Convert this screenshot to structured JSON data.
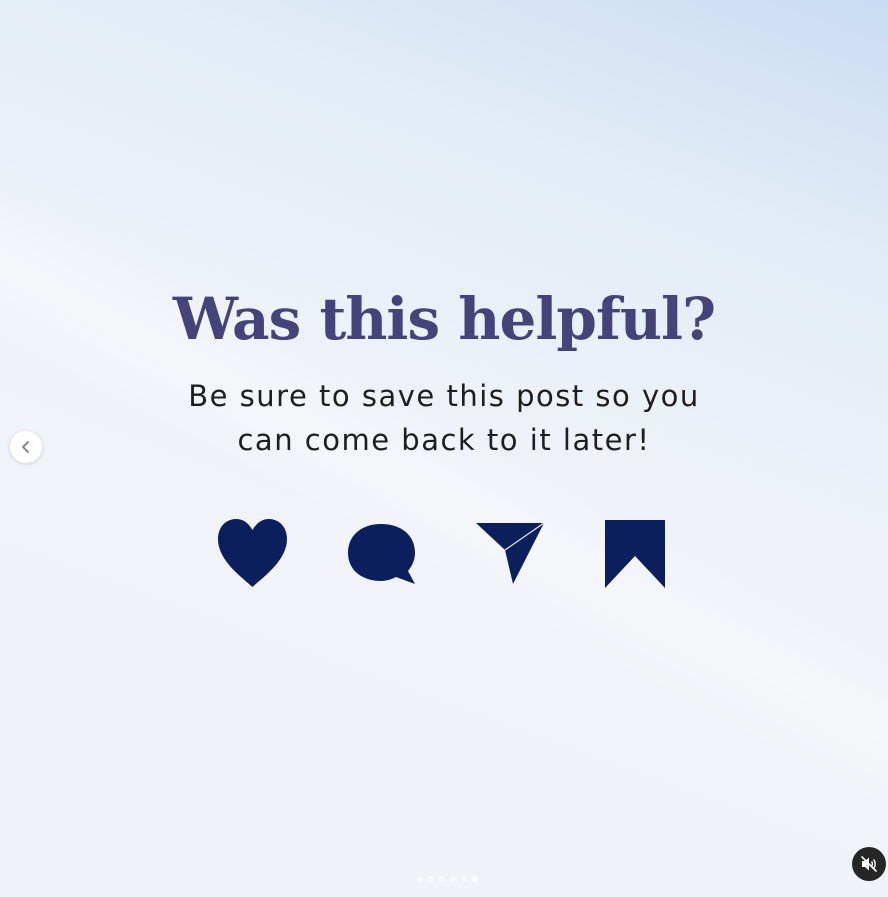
{
  "slide": {
    "headline": "Was this helpful?",
    "subtext_line1": "Be sure to save this post so you",
    "subtext_line2": "can come back to it later!",
    "icons": [
      "heart-icon",
      "comment-icon",
      "share-icon",
      "bookmark-icon"
    ],
    "icon_color": "#0b1f5c",
    "headline_color": "#45437a"
  },
  "carousel": {
    "total_slides": 6,
    "active_slide": 6
  },
  "controls": {
    "prev_icon": "chevron-left-icon",
    "audio_icon": "speaker-muted-icon"
  }
}
